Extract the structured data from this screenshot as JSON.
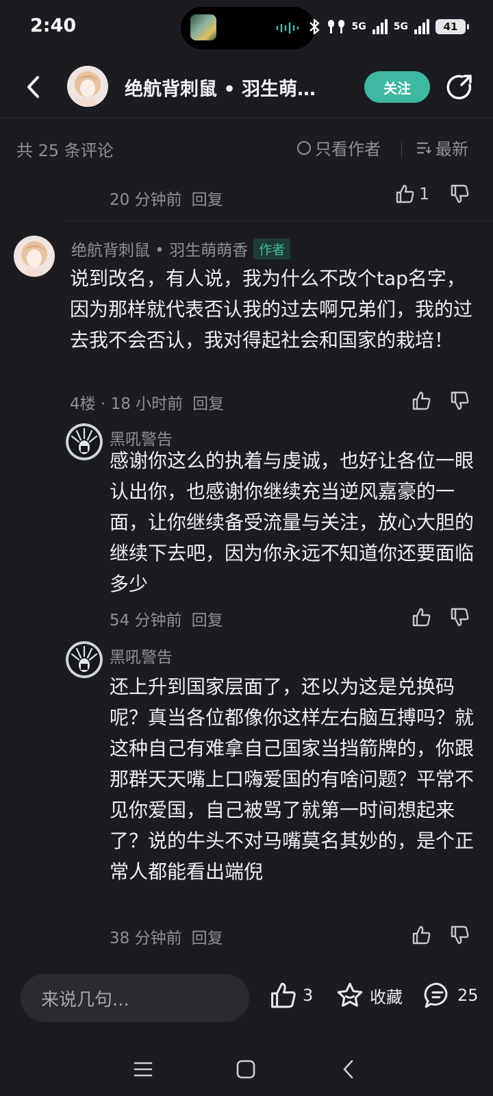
{
  "status_bar": {
    "time": "2:40",
    "network_label_1": "5G",
    "network_label_2": "5G",
    "battery": "41"
  },
  "header": {
    "title": "绝航背刺鼠 • 羽生萌…",
    "follow_label": "关注",
    "accent_color": "#3fb8a2"
  },
  "comments_bar": {
    "count_text": "共 25 条评论",
    "author_only_label": "只看作者",
    "sort_label": "最新"
  },
  "prev_reply_meta": {
    "time": "20 分钟前",
    "reply_label": "回复",
    "like_count": "1"
  },
  "main_comment": {
    "user": "绝航背刺鼠 • 羽生萌萌香",
    "badge": "作者",
    "text": "说到改名，有人说，我为什么不改个tap名字，因为那样就代表否认我的过去啊兄弟们，我的过去我不会否认，我对得起社会和国家的栽培！",
    "floor_time": "4楼 · 18 小时前",
    "reply_label": "回复"
  },
  "replies": [
    {
      "user": "黑吼警告",
      "text": "感谢你这么的执着与虔诚，也好让各位一眼认出你，也感谢你继续充当逆风嘉豪的一面，让你继续备受流量与关注，放心大胆的继续下去吧，因为你永远不知道你还要面临多少",
      "time": "54 分钟前",
      "reply_label": "回复"
    },
    {
      "user": "黑吼警告",
      "text": "还上升到国家层面了，还以为这是兑换码呢？真当各位都像你这样左右脑互搏吗？就这种自己有难拿自己国家当挡箭牌的，你跟那群天天嘴上口嗨爱国的有啥问题？平常不见你爱国，自己被骂了就第一时间想起来了？说的牛头不对马嘴莫名其妙的，是个正常人都能看出端倪",
      "time": "38 分钟前",
      "reply_label": "回复"
    }
  ],
  "bottom_bar": {
    "input_placeholder": "来说几句...",
    "like_count": "3",
    "favorite_label": "收藏",
    "comment_count": "25"
  },
  "icons": {
    "back": "back-arrow-icon",
    "share": "share-icon",
    "like": "thumbs-up-icon",
    "dislike": "thumbs-down-icon",
    "favorite": "star-icon",
    "comment": "comment-bubble-icon",
    "sort": "sort-lines-icon"
  }
}
